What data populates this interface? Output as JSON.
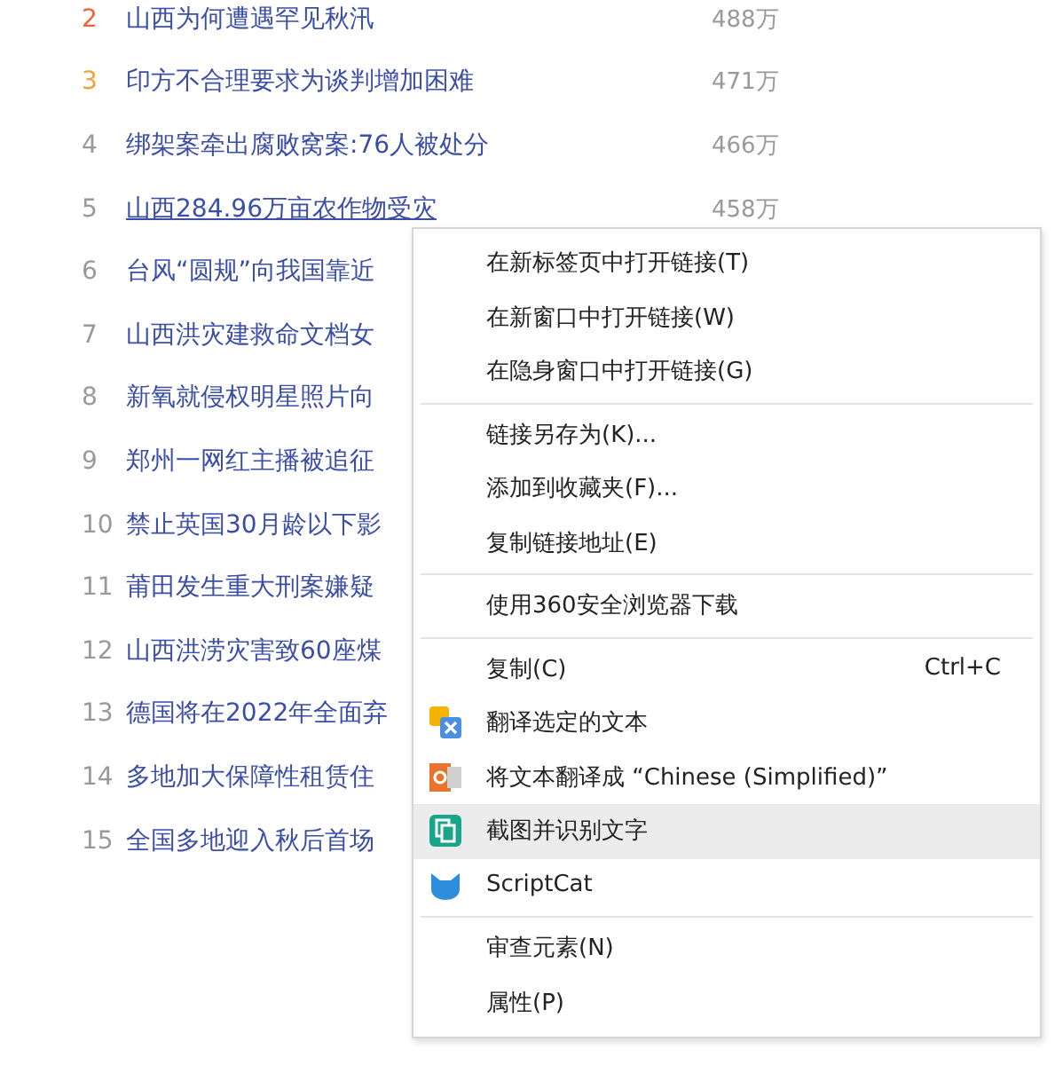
{
  "hot_list": [
    {
      "rank": "2",
      "color": "#e8663a",
      "title": "山西为何遭遇罕见秋汛",
      "count": "488万",
      "hovered": false
    },
    {
      "rank": "3",
      "color": "#f0a33c",
      "title": "印方不合理要求为谈判增加困难",
      "count": "471万",
      "hovered": false
    },
    {
      "rank": "4",
      "color": "#999999",
      "title": "绑架案牵出腐败窝案:76人被处分",
      "count": "466万",
      "hovered": false
    },
    {
      "rank": "5",
      "color": "#999999",
      "title": "山西284.96万亩农作物受灾",
      "count": "458万",
      "hovered": true
    },
    {
      "rank": "6",
      "color": "#999999",
      "title": "台风“圆规”向我国靠近",
      "hovered": false
    },
    {
      "rank": "7",
      "color": "#999999",
      "title": "山西洪灾建救命文档女",
      "hovered": false
    },
    {
      "rank": "8",
      "color": "#999999",
      "title": "新氧就侵权明星照片向",
      "hovered": false
    },
    {
      "rank": "9",
      "color": "#999999",
      "title": "郑州一网红主播被追征",
      "hovered": false
    },
    {
      "rank": "10",
      "color": "#999999",
      "title": "禁止英国30月龄以下影",
      "hovered": false
    },
    {
      "rank": "11",
      "color": "#999999",
      "title": "莆田发生重大刑案嫌疑",
      "hovered": false
    },
    {
      "rank": "12",
      "color": "#999999",
      "title": "山西洪涝灾害致60座煤",
      "hovered": false
    },
    {
      "rank": "13",
      "color": "#999999",
      "title": "德国将在2022年全面弃",
      "hovered": false
    },
    {
      "rank": "14",
      "color": "#999999",
      "title": "多地加大保障性租赁住",
      "hovered": false
    },
    {
      "rank": "15",
      "color": "#999999",
      "title": "全国多地迎入秋后首场",
      "hovered": false
    }
  ],
  "context_menu": {
    "sections": [
      {
        "items": [
          {
            "label": "在新标签页中打开链接(T)",
            "selected": false
          },
          {
            "label": "在新窗口中打开链接(W)",
            "selected": false
          },
          {
            "label": "在隐身窗口中打开链接(G)",
            "selected": false
          }
        ]
      },
      {
        "items": [
          {
            "label": "链接另存为(K)...",
            "selected": false
          },
          {
            "label": "添加到收藏夹(F)...",
            "selected": false
          },
          {
            "label": "复制链接地址(E)",
            "selected": false
          }
        ]
      },
      {
        "items": [
          {
            "label": "使用360安全浏览器下载",
            "selected": false
          }
        ]
      },
      {
        "items": [
          {
            "label": "复制(C)",
            "shortcut": "Ctrl+C",
            "selected": false
          },
          {
            "label": "翻译选定的文本",
            "kind": "translate",
            "selected": false
          },
          {
            "label": "将文本翻译成 “Chinese (Simplified)”",
            "kind": "google-translate",
            "selected": false
          },
          {
            "label": "截图并识别文字",
            "kind": "screenshot",
            "selected": true
          },
          {
            "label": "ScriptCat",
            "kind": "cat",
            "selected": false
          }
        ]
      },
      {
        "items": [
          {
            "label": "审查元素(N)",
            "selected": false
          },
          {
            "label": "属性(P)",
            "selected": false
          }
        ]
      }
    ]
  }
}
